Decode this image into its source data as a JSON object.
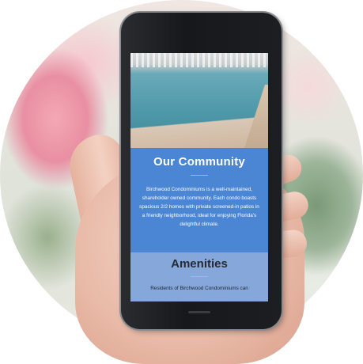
{
  "community": {
    "title": "Our Community",
    "body": "Birchwood Condominiums is a well-maintained, shareholder owned community. Each condo boasts spacious 2/2 homes with private screened-in patios in a friendly neighborhood, ideal for enjoying Florida's delightful climate."
  },
  "amenities": {
    "title": "Amenities",
    "body": "Residents of Birchwood Condominiums can"
  },
  "colors": {
    "community_bg": "#4a86d4",
    "amenities_bg": "#86a7da",
    "accent_rule": "#e8b04a"
  },
  "icons": {
    "pool_image": "swimming-pool-photo"
  }
}
